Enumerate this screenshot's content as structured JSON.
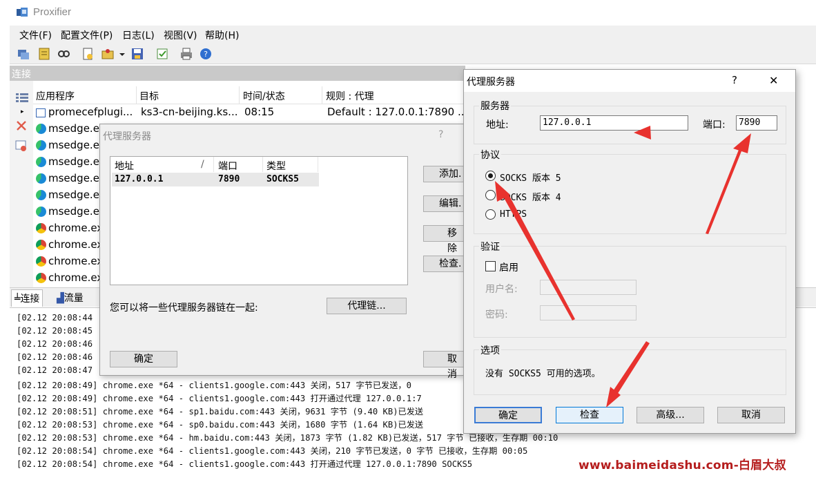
{
  "app": {
    "title": "Proxifier"
  },
  "menu": [
    "文件(F)",
    "配置文件(P)",
    "日志(L)",
    "视图(V)",
    "帮助(H)"
  ],
  "connections": {
    "header": "连接",
    "columns": [
      "应用程序",
      "目标",
      "时间/状态",
      "规则 : 代理"
    ],
    "rows": [
      {
        "app": "promecefplugi...",
        "target": "ks3-cn-beijing.ks...",
        "time": "08:15",
        "rule": "Default : 127.0.0.1:7890 ...",
        "icon": "window-icon"
      },
      {
        "app": "msedge.ex",
        "icon": "edge-icon"
      },
      {
        "app": "msedge.ex",
        "icon": "edge-icon"
      },
      {
        "app": "msedge.ex",
        "icon": "edge-icon"
      },
      {
        "app": "msedge.ex",
        "icon": "edge-icon"
      },
      {
        "app": "msedge.ex",
        "icon": "edge-icon"
      },
      {
        "app": "msedge.ex",
        "icon": "edge-icon"
      },
      {
        "app": "chrome.ex",
        "icon": "chrome-icon"
      },
      {
        "app": "chrome.ex",
        "icon": "chrome-icon"
      },
      {
        "app": "chrome.ex",
        "icon": "chrome-icon"
      },
      {
        "app": "chrome.ex",
        "icon": "chrome-icon"
      }
    ]
  },
  "tabs": {
    "connections": "连接",
    "traffic": "流量"
  },
  "log": [
    "[02.12 20:08:44",
    "[02.12 20:08:45",
    "[02.12 20:08:46",
    "[02.12 20:08:46",
    "[02.12 20:08:47",
    "[02.12 20:08:49] chrome.exe *64 - clients1.google.com:443 关闭，517 字节已发送，0",
    "[02.12 20:08:49] chrome.exe *64 - clients1.google.com:443 打开通过代理 127.0.0.1:7",
    "[02.12 20:08:51] chrome.exe *64 - sp1.baidu.com:443 关闭，9631 字节 (9.40 KB)已发送",
    "[02.12 20:08:53] chrome.exe *64 - sp0.baidu.com:443 关闭，1680 字节 (1.64 KB)已发送",
    "[02.12 20:08:53] chrome.exe *64 - hm.baidu.com:443 关闭，1873 字节 (1.82 KB)已发送，517 字节 已接收，生存期 00:10",
    "[02.12 20:08:54] chrome.exe *64 - clients1.google.com:443 关闭，210 字节已发送，0 字节 已接收，生存期 00:05",
    "[02.12 20:08:54] chrome.exe *64 - clients1.google.com:443 打开通过代理 127.0.0.1:7890 SOCKS5"
  ],
  "proxy_list_dialog": {
    "title": "代理服务器",
    "help": "?",
    "columns": [
      "地址",
      "端口",
      "类型"
    ],
    "sort_marker": "/",
    "rows": [
      {
        "address": "127.0.0.1",
        "port": "7890",
        "type": "SOCKS5"
      }
    ],
    "buttons": {
      "add": "添加.",
      "edit": "编辑.",
      "remove": "移除",
      "check": "检查."
    },
    "chain_text": "您可以将一些代理服务器链在一起:",
    "chain_button": "代理链...",
    "ok": "确定",
    "cancel": "取消"
  },
  "proxy_dialog": {
    "title": "代理服务器",
    "help": "?",
    "close": "✕",
    "server_group": "服务器",
    "address_label": "地址:",
    "address_value": "127.0.0.1",
    "port_label": "端口:",
    "port_value": "7890",
    "protocol_group": "协议",
    "protocols": [
      {
        "label": "SOCKS 版本 5",
        "selected": true
      },
      {
        "label": "SOCKS 版本 4",
        "selected": false
      },
      {
        "label": "HTTPS",
        "selected": false
      }
    ],
    "auth_group": "验证",
    "enable_label": "启用",
    "enable_checked": false,
    "username_label": "用户名:",
    "password_label": "密码:",
    "options_group": "选项",
    "options_text": "没有 SOCKS5 可用的选项。",
    "buttons": {
      "ok": "确定",
      "check": "检查",
      "advanced": "高级...",
      "cancel": "取消"
    }
  },
  "watermark": "www.baimeidashu.com-白眉大叔",
  "colors": {
    "annotation_arrow": "#e8322e",
    "watermark": "#b51d1d",
    "header_gray": "#c9c9c9"
  }
}
